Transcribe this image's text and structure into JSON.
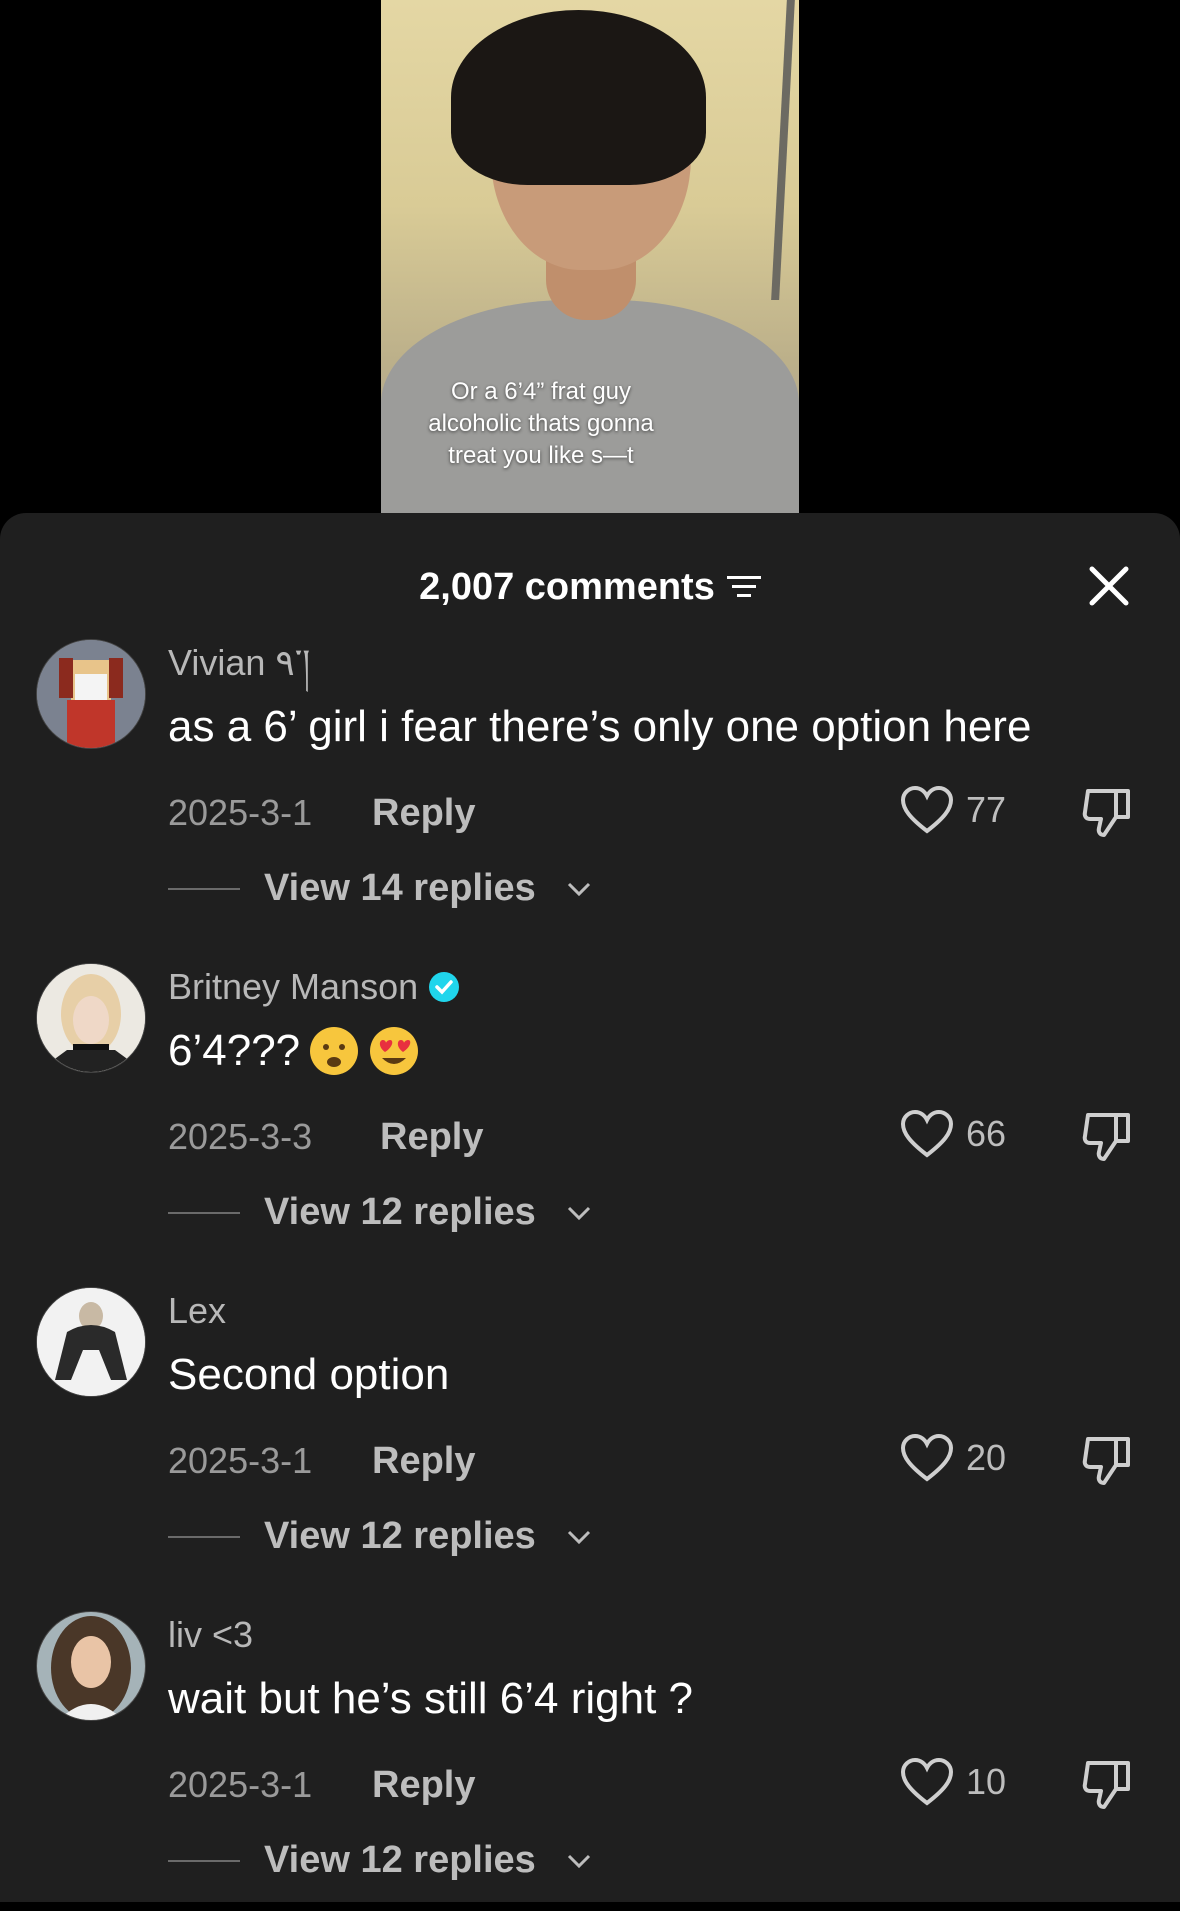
{
  "video": {
    "caption_lines": [
      "Or a 6’4” frat guy",
      "alcoholic thats gonna",
      "treat you like s—t"
    ]
  },
  "header": {
    "count_label": "2,007 comments",
    "filter_icon": "filter-icon",
    "close_icon": "close-icon"
  },
  "comments": [
    {
      "username": "Vivian ٩་།",
      "verified": false,
      "text": "as a 6’ girl i fear there’s only one option here",
      "date": "2025-3-1",
      "reply_label": "Reply",
      "likes": "77",
      "view_replies": "View 14 replies",
      "avatar_color": "#7a6b5a"
    },
    {
      "username": "Britney Manson",
      "verified": true,
      "text": "6’4???",
      "emojis": [
        "frowning-face-emoji",
        "heart-eyes-emoji"
      ],
      "date": "2025-3-3",
      "reply_label": "Reply",
      "likes": "66",
      "view_replies": "View 12 replies",
      "avatar_color": "#d9d6cf"
    },
    {
      "username": "Lex",
      "verified": false,
      "text": "Second option",
      "date": "2025-3-1",
      "reply_label": "Reply",
      "likes": "20",
      "view_replies": "View 12 replies",
      "avatar_color": "#e8e8e8"
    },
    {
      "username": "liv <3",
      "verified": false,
      "text": "wait but he’s still 6’4 right ?",
      "date": "2025-3-1",
      "reply_label": "Reply",
      "likes": "10",
      "view_replies": "View 12 replies",
      "avatar_color": "#5a4a3e"
    }
  ],
  "colors": {
    "sheet": "#1f1f1f",
    "verified": "#20d5ec",
    "muted": "#9a9a9a"
  }
}
